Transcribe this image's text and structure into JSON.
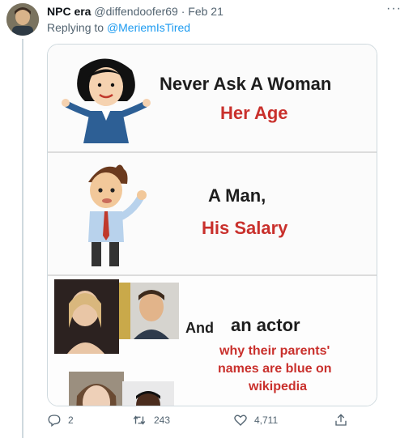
{
  "tweet": {
    "author_name": "NPC era",
    "author_handle": "@diffendoofer69",
    "separator": "·",
    "date": "Feb 21",
    "reply_prefix": "Replying to",
    "reply_handle": "@MeriemIsTired",
    "more_label": "···"
  },
  "meme": {
    "panel1_line1": "Never Ask A Woman",
    "panel1_line2": "Her Age",
    "panel2_line1": "A Man,",
    "panel2_line2": "His Salary",
    "panel3_and": "And",
    "panel3_actor": "an actor",
    "panel3_line1": "why their parents'",
    "panel3_line2": "names are blue on",
    "panel3_line3": "wikipedia"
  },
  "actions": {
    "replies": "2",
    "retweets": "243",
    "likes": "4,711"
  },
  "colors": {
    "link": "#1d9bf0",
    "muted": "#536471",
    "meme_red": "#c9302c",
    "retweet_green": "#00ba7c"
  },
  "icons": [
    "reply-icon",
    "retweet-icon",
    "like-icon",
    "share-icon",
    "more-icon"
  ]
}
